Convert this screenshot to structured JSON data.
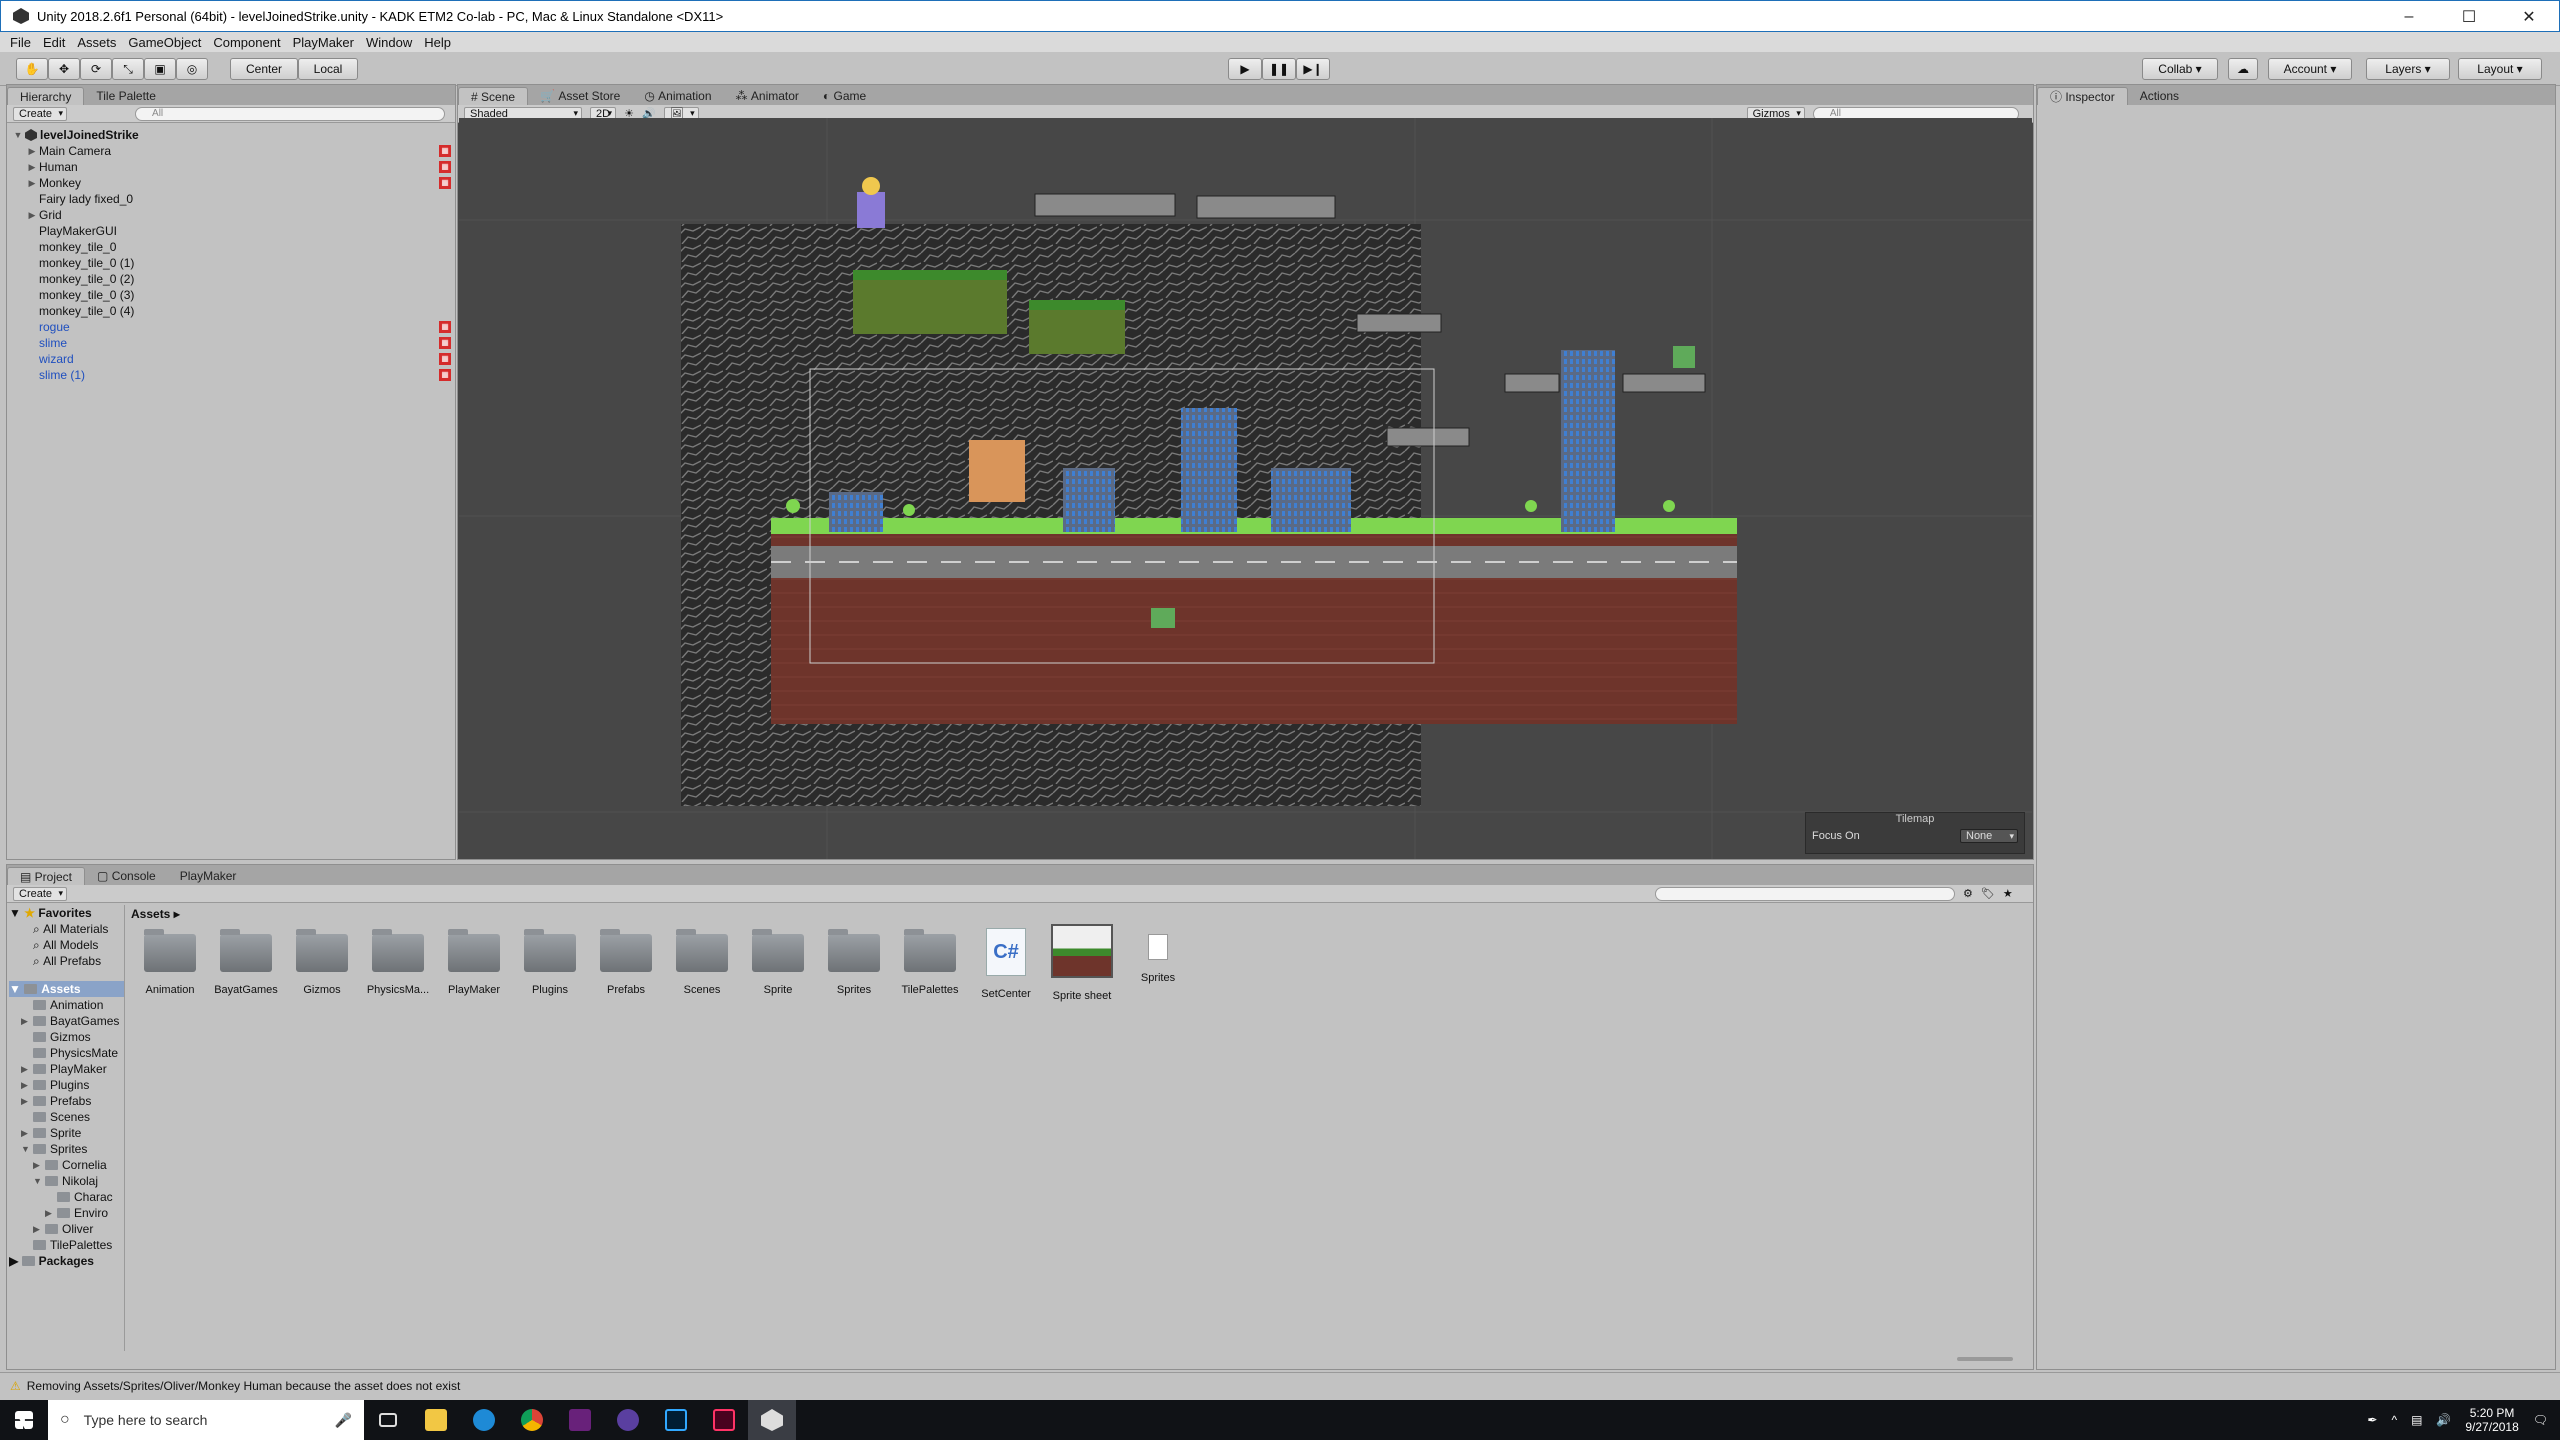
{
  "window": {
    "title": "Unity 2018.2.6f1 Personal (64bit) - levelJoinedStrike.unity - KADK ETM2 Co-lab - PC, Mac & Linux Standalone <DX11>"
  },
  "menu": [
    "File",
    "Edit",
    "Assets",
    "GameObject",
    "Component",
    "PlayMaker",
    "Window",
    "Help"
  ],
  "toolbar": {
    "pivot": "Center",
    "space": "Local",
    "collab": "Collab",
    "account": "Account",
    "layers": "Layers",
    "layout": "Layout"
  },
  "hierarchy": {
    "tabs": [
      "Hierarchy",
      "Tile Palette"
    ],
    "create": "Create",
    "search_placeholder": "All",
    "scene": "levelJoinedStrike",
    "items": [
      {
        "label": "Main Camera",
        "arrow": true,
        "blue": false,
        "mark": true
      },
      {
        "label": "Human",
        "arrow": true,
        "blue": false,
        "mark": true
      },
      {
        "label": "Monkey",
        "arrow": true,
        "blue": false,
        "mark": true
      },
      {
        "label": "Fairy lady fixed_0",
        "arrow": false,
        "blue": false,
        "mark": false
      },
      {
        "label": "Grid",
        "arrow": true,
        "blue": false,
        "mark": false
      },
      {
        "label": "PlayMakerGUI",
        "arrow": false,
        "blue": false,
        "mark": false
      },
      {
        "label": "monkey_tile_0",
        "arrow": false,
        "blue": false,
        "mark": false
      },
      {
        "label": "monkey_tile_0 (1)",
        "arrow": false,
        "blue": false,
        "mark": false
      },
      {
        "label": "monkey_tile_0 (2)",
        "arrow": false,
        "blue": false,
        "mark": false
      },
      {
        "label": "monkey_tile_0 (3)",
        "arrow": false,
        "blue": false,
        "mark": false
      },
      {
        "label": "monkey_tile_0 (4)",
        "arrow": false,
        "blue": false,
        "mark": false
      },
      {
        "label": "rogue",
        "arrow": false,
        "blue": true,
        "mark": true
      },
      {
        "label": "slime",
        "arrow": false,
        "blue": true,
        "mark": true
      },
      {
        "label": "wizard",
        "arrow": false,
        "blue": true,
        "mark": true
      },
      {
        "label": "slime (1)",
        "arrow": false,
        "blue": true,
        "mark": true
      }
    ]
  },
  "scene": {
    "tabs": [
      "Scene",
      "Asset Store",
      "Animation",
      "Animator",
      "Game"
    ],
    "shading": "Shaded",
    "mode2d": "2D",
    "gizmos": "Gizmos",
    "search_placeholder": "All",
    "tilemap_title": "Tilemap",
    "focus_label": "Focus On",
    "focus_value": "None"
  },
  "inspector": {
    "tabs": [
      "Inspector",
      "Actions"
    ]
  },
  "project": {
    "tabs": [
      "Project",
      "Console",
      "PlayMaker"
    ],
    "create": "Create",
    "favorites": {
      "label": "Favorites",
      "items": [
        "All Materials",
        "All Models",
        "All Prefabs"
      ]
    },
    "assets_root": "Assets",
    "tree": [
      {
        "label": "Animation",
        "indent": 1,
        "arrow": ""
      },
      {
        "label": "BayatGames",
        "indent": 1,
        "arrow": "▶"
      },
      {
        "label": "Gizmos",
        "indent": 1,
        "arrow": ""
      },
      {
        "label": "PhysicsMate",
        "indent": 1,
        "arrow": ""
      },
      {
        "label": "PlayMaker",
        "indent": 1,
        "arrow": "▶"
      },
      {
        "label": "Plugins",
        "indent": 1,
        "arrow": "▶"
      },
      {
        "label": "Prefabs",
        "indent": 1,
        "arrow": "▶"
      },
      {
        "label": "Scenes",
        "indent": 1,
        "arrow": ""
      },
      {
        "label": "Sprite",
        "indent": 1,
        "arrow": "▶"
      },
      {
        "label": "Sprites",
        "indent": 1,
        "arrow": "▼"
      },
      {
        "label": "Cornelia",
        "indent": 2,
        "arrow": "▶"
      },
      {
        "label": "Nikolaj",
        "indent": 2,
        "arrow": "▼"
      },
      {
        "label": "Charac",
        "indent": 3,
        "arrow": ""
      },
      {
        "label": "Enviro",
        "indent": 3,
        "arrow": "▶"
      },
      {
        "label": "Oliver",
        "indent": 2,
        "arrow": "▶"
      },
      {
        "label": "TilePalettes",
        "indent": 1,
        "arrow": ""
      }
    ],
    "packages": "Packages",
    "breadcrumb": "Assets",
    "items": [
      "Animation",
      "BayatGames",
      "Gizmos",
      "PhysicsMa...",
      "PlayMaker",
      "Plugins",
      "Prefabs",
      "Scenes",
      "Sprite",
      "Sprites",
      "TilePalettes",
      "SetCenter",
      "Sprite sheet",
      "Sprites"
    ]
  },
  "status": {
    "message": "Removing Assets/Sprites/Oliver/Monkey Human because the asset does not exist"
  },
  "taskbar": {
    "search_placeholder": "Type here to search",
    "time": "5:20 PM",
    "date": "9/27/2018"
  }
}
